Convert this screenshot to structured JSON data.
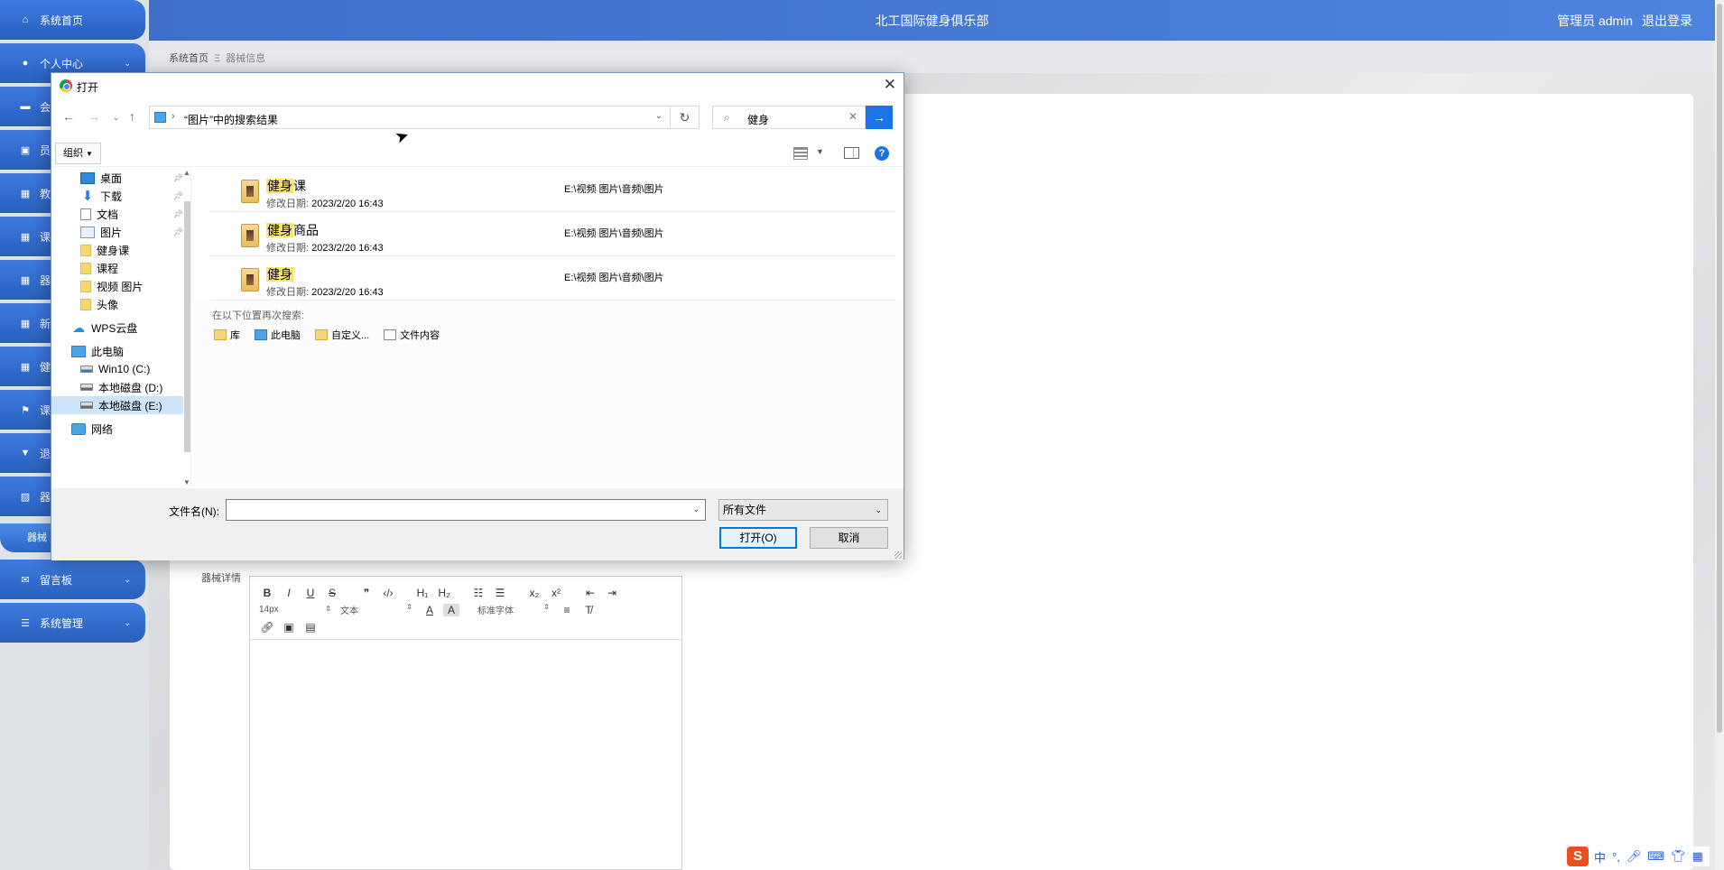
{
  "header": {
    "title": "北工国际健身俱乐部",
    "user_role": "管理员 admin",
    "logout": "退出登录"
  },
  "breadcrumb": {
    "home": "系统首页",
    "separator": "Ξ",
    "current": "器械信息"
  },
  "sidebar": {
    "items": [
      {
        "label": "系统首页",
        "icon": "home-icon"
      },
      {
        "label": "个人中心",
        "icon": "user-icon"
      },
      {
        "label": "会",
        "icon": "monitor-icon"
      },
      {
        "label": "员",
        "icon": "id-card-icon"
      },
      {
        "label": "教",
        "icon": "grid-icon"
      },
      {
        "label": "课",
        "icon": "grid-icon"
      },
      {
        "label": "器",
        "icon": "grid-icon"
      },
      {
        "label": "新",
        "icon": "grid-icon"
      },
      {
        "label": "健",
        "icon": "grid-icon"
      },
      {
        "label": "课",
        "icon": "flag-icon"
      },
      {
        "label": "退",
        "icon": "pin-icon"
      },
      {
        "label": "器",
        "icon": "chart-icon"
      },
      {
        "label": "留言板",
        "icon": "message-icon"
      },
      {
        "label": "系统管理",
        "icon": "list-icon"
      }
    ],
    "active_sub": "器械"
  },
  "editor": {
    "label": "器械详情",
    "font_size": "14px",
    "paragraph": "文本",
    "font_family": "标准字体"
  },
  "dialog": {
    "title": "打开",
    "address_path": "“图片”中的搜索结果",
    "search_value": "健身",
    "organize": "组织",
    "nav_tree": [
      {
        "label": "桌面",
        "icon": "desktop-icon",
        "pinned": true
      },
      {
        "label": "下载",
        "icon": "download-icon",
        "pinned": true
      },
      {
        "label": "文档",
        "icon": "document-icon",
        "pinned": true
      },
      {
        "label": "图片",
        "icon": "pictures-icon",
        "pinned": true
      },
      {
        "label": "健身课",
        "icon": "folder-icon",
        "pinned": false
      },
      {
        "label": "课程",
        "icon": "folder-icon",
        "pinned": false
      },
      {
        "label": "视频 图片",
        "icon": "folder-icon",
        "pinned": false
      },
      {
        "label": "头像",
        "icon": "folder-icon",
        "pinned": false
      },
      {
        "label": "WPS云盘",
        "icon": "cloud-icon",
        "pinned": false
      },
      {
        "label": "此电脑",
        "icon": "computer-icon",
        "pinned": false
      },
      {
        "label": "Win10 (C:)",
        "icon": "windows-drive-icon",
        "pinned": false
      },
      {
        "label": "本地磁盘 (D:)",
        "icon": "drive-icon",
        "pinned": false
      },
      {
        "label": "本地磁盘 (E:)",
        "icon": "drive-icon",
        "pinned": false,
        "selected": true
      },
      {
        "label": "网络",
        "icon": "network-icon",
        "pinned": false
      }
    ],
    "results": [
      {
        "name_highlight": "健身",
        "name_rest": "课",
        "date_label": "修改日期:",
        "date": "2023/2/20 16:43",
        "path": "E:\\视频 图片\\音频\\图片"
      },
      {
        "name_highlight": "健身",
        "name_rest": "商品",
        "date_label": "修改日期:",
        "date": "2023/2/20 16:43",
        "path": "E:\\视频 图片\\音频\\图片"
      },
      {
        "name_highlight": "健身",
        "name_rest": "",
        "date_label": "修改日期:",
        "date": "2023/2/20 16:43",
        "path": "E:\\视频 图片\\音频\\图片"
      }
    ],
    "search_again_label": "在以下位置再次搜索:",
    "search_again_links": [
      {
        "label": "库",
        "icon": "library-icon"
      },
      {
        "label": "此电脑",
        "icon": "computer-icon"
      },
      {
        "label": "自定义...",
        "icon": "custom-folder-icon"
      },
      {
        "label": "文件内容",
        "icon": "file-content-icon"
      }
    ],
    "filename_label": "文件名(N):",
    "filename_value": "",
    "filetype": "所有文件",
    "open_button": "打开(O)",
    "cancel_button": "取消"
  },
  "ime": {
    "logo": "S",
    "mode": "中"
  }
}
